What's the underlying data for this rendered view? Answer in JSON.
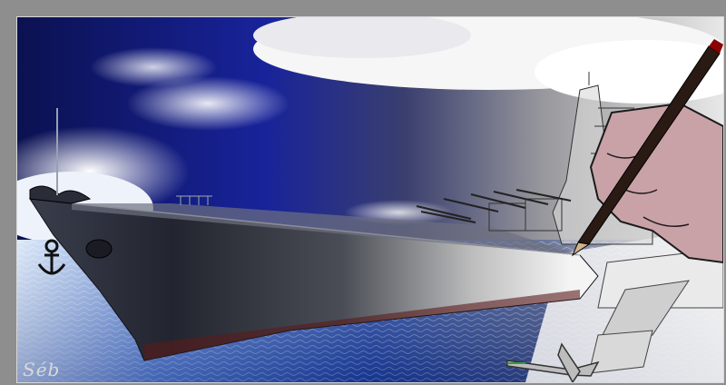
{
  "artwork": {
    "signature": "Séb"
  },
  "colors": {
    "frame": "#8e8e8e",
    "sky_dark": "#0b1150",
    "sky_blue": "#1a2aa8",
    "cloud": "#f4f4f6",
    "sea_blue": "#1f4fb3",
    "sea_light": "#d7e6f7",
    "hull_dark": "#1b1e28",
    "hull_gray": "#8c8c8c",
    "sketch_bg": "#ffffff",
    "hand_skin": "#c9a2a8",
    "pencil": "#2a1a14"
  },
  "icons": [
    "ship-anchor-icon",
    "pencil-icon",
    "drawing-hand-icon",
    "aircraft-icon"
  ]
}
